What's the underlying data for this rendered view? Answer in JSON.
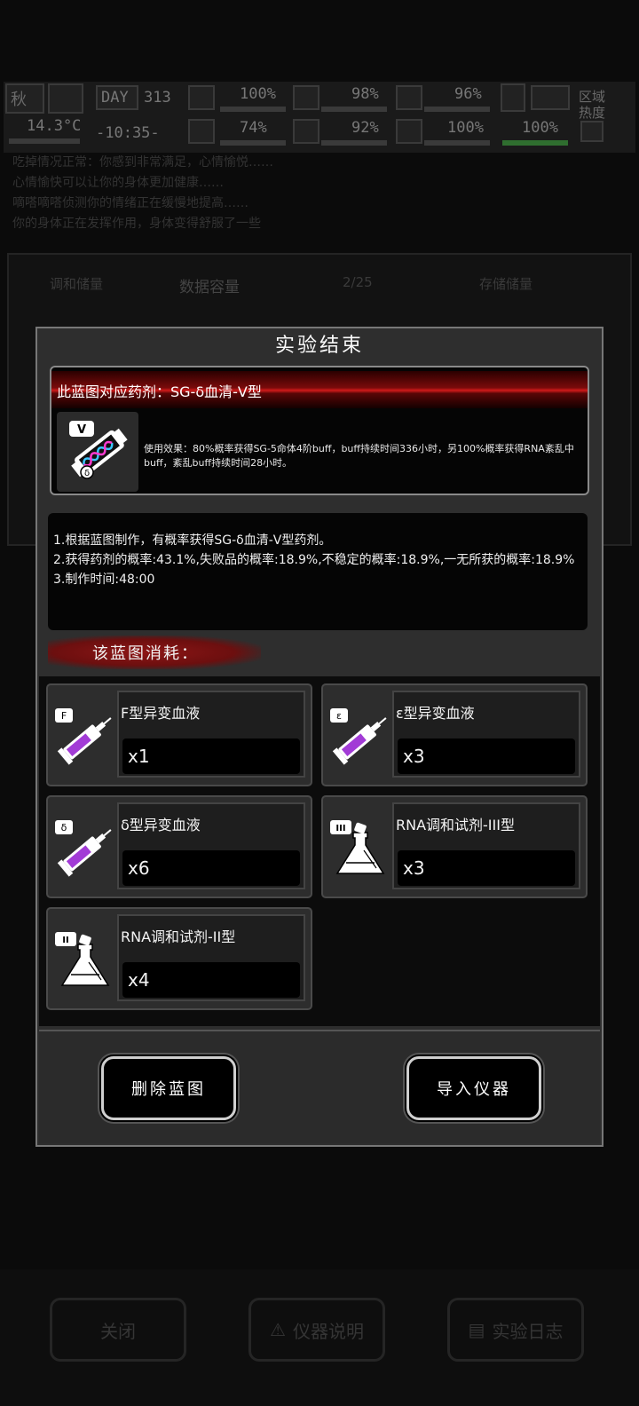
{
  "hud": {
    "season": "秋",
    "day_label": "DAY",
    "day_number": "313",
    "temperature": "14.3°C",
    "clock": "-10:35-",
    "health_pct": "100%",
    "stamina_pct": "98%",
    "stomach_pct": "96%",
    "mood_pct": "74%",
    "water_pct": "92%",
    "heart_pct": "100%",
    "energy_pct": "100%",
    "area_heat_label": "区域热度"
  },
  "background": {
    "log_lines": [
      "吃掉情况正常：你感到非常满足，心情愉悦……",
      "心情愉快可以让你的身体更加健康……",
      "嘀嗒嘀嗒侦测你的情绪正在缓慢地提高……",
      "你的身体正在发挥作用，身体变得舒服了一些"
    ],
    "panel_left_header": "调和储量",
    "panel_title": "数据容量",
    "panel_count": "2/25",
    "panel_right_header": "存储储量",
    "bottom_buttons": [
      "关闭",
      "仪器说明",
      "实验日志"
    ]
  },
  "modal": {
    "title": "实验结束",
    "blueprint_banner": "此蓝图对应药剂：SG-δ血清-V型",
    "blueprint_desc": "使用效果：80%概率获得SG-5命体4阶buff，buff持续时间336小时，另100%概率获得RNA紊乱中buff，紊乱buff持续时间28小时。",
    "info_lines": [
      "1.根据蓝图制作，有概率获得SG-δ血清-V型药剂。",
      "2.获得药剂的概率:43.1%,失败品的概率:18.9%,不稳定的概率:18.9%,一无所获的概率:18.9%",
      "3.制作时间:48:00"
    ],
    "consume_label": "该蓝图消耗：",
    "materials": [
      {
        "badge": "F",
        "name": "F型异变血液",
        "qty": "x1",
        "kind": "syringe"
      },
      {
        "badge": "ε",
        "name": "ε型异变血液",
        "qty": "x3",
        "kind": "syringe"
      },
      {
        "badge": "δ",
        "name": "δ型异变血液",
        "qty": "x6",
        "kind": "syringe"
      },
      {
        "badge": "III",
        "name": "RNA调和试剂-III型",
        "qty": "x3",
        "kind": "flask"
      },
      {
        "badge": "II",
        "name": "RNA调和试剂-II型",
        "qty": "x4",
        "kind": "flask"
      }
    ],
    "delete_button": "删除蓝图",
    "import_button": "导入仪器"
  },
  "colors": {
    "accent_red": "#d11a1a",
    "liquid_purple": "#a23bd6",
    "helix_cyan": "#3ac6ff",
    "helix_magenta": "#ff3ad0"
  }
}
